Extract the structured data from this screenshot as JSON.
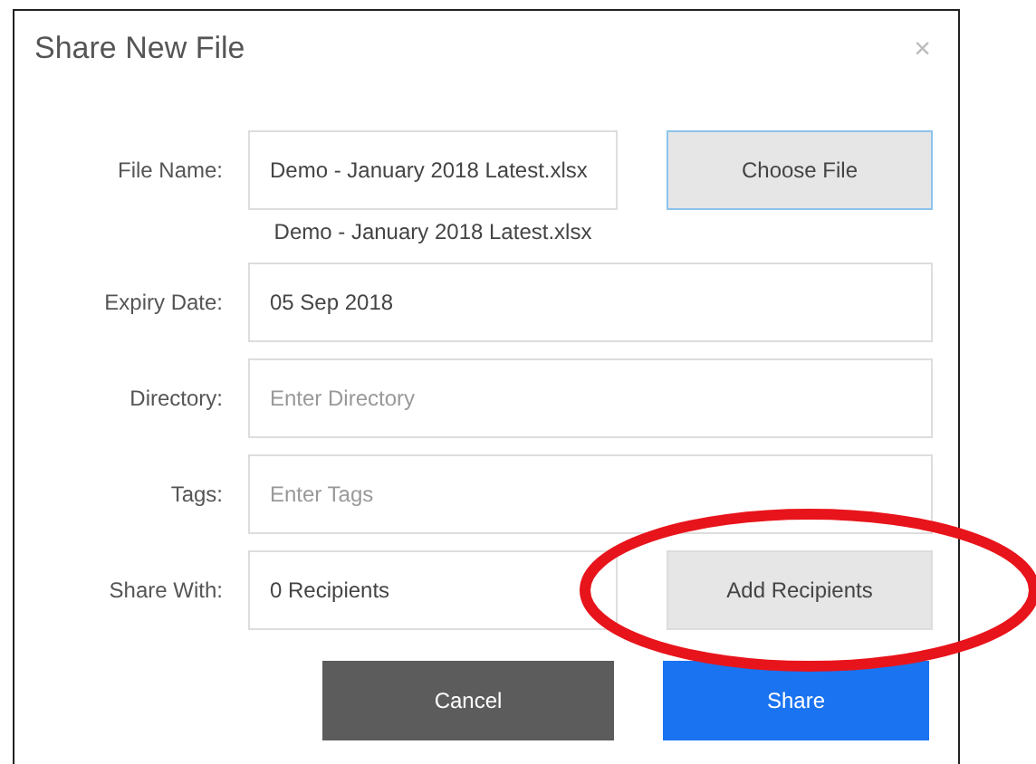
{
  "dialog": {
    "title": "Share New File",
    "close": "×"
  },
  "fields": [
    {
      "kind": "file",
      "label": "File Name:",
      "value": "Demo - January 2018 Latest.xlsx",
      "button": "Choose File",
      "caption": "Demo - January 2018 Latest.xlsx"
    },
    {
      "kind": "text",
      "label": "Expiry Date:",
      "value": "05 Sep 2018"
    },
    {
      "kind": "text",
      "label": "Directory:",
      "placeholder": "Enter Directory"
    },
    {
      "kind": "text",
      "label": "Tags:",
      "placeholder": "Enter Tags"
    },
    {
      "kind": "picker",
      "label": "Share With:",
      "value": "0 Recipients",
      "button": "Add Recipients"
    }
  ],
  "buttons": [
    {
      "kind": "secondary",
      "label": "Cancel"
    },
    {
      "kind": "primary",
      "label": "Share"
    }
  ]
}
